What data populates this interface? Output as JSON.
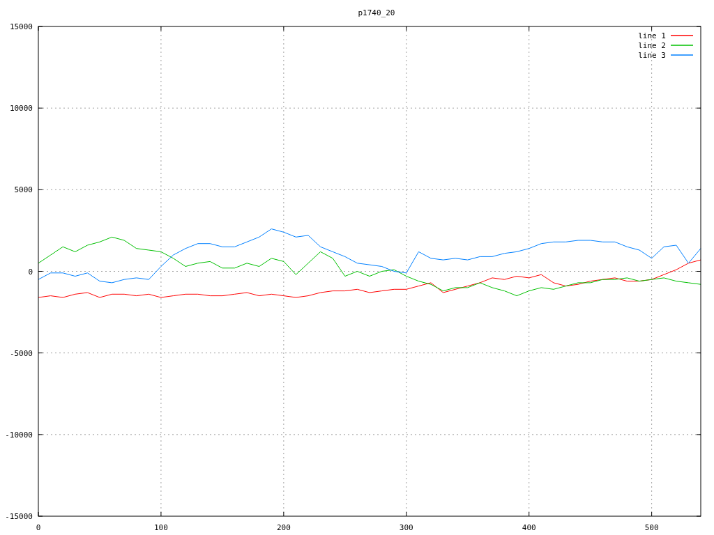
{
  "chart_data": {
    "type": "line",
    "title": "p1740_20",
    "x": [
      0,
      10,
      20,
      30,
      40,
      50,
      60,
      70,
      80,
      90,
      100,
      110,
      120,
      130,
      140,
      150,
      160,
      170,
      180,
      190,
      200,
      210,
      220,
      230,
      240,
      250,
      260,
      270,
      280,
      290,
      300,
      310,
      320,
      330,
      340,
      350,
      360,
      370,
      380,
      390,
      400,
      410,
      420,
      430,
      440,
      450,
      460,
      470,
      480,
      490,
      500,
      510,
      520,
      530,
      540
    ],
    "series": [
      {
        "name": "line 1",
        "color": "#ff0000",
        "values": [
          -1600,
          -1500,
          -1600,
          -1400,
          -1300,
          -1600,
          -1400,
          -1400,
          -1500,
          -1400,
          -1600,
          -1500,
          -1400,
          -1400,
          -1500,
          -1500,
          -1400,
          -1300,
          -1500,
          -1400,
          -1500,
          -1600,
          -1500,
          -1300,
          -1200,
          -1200,
          -1100,
          -1300,
          -1200,
          -1100,
          -1100,
          -900,
          -700,
          -1300,
          -1100,
          -900,
          -700,
          -400,
          -500,
          -300,
          -400,
          -200,
          -700,
          -900,
          -800,
          -600,
          -500,
          -400,
          -600,
          -600,
          -500,
          -200,
          100,
          500,
          700
        ]
      },
      {
        "name": "line 2",
        "color": "#00c000",
        "values": [
          500,
          1000,
          1500,
          1200,
          1600,
          1800,
          2100,
          1900,
          1400,
          1300,
          1200,
          800,
          300,
          500,
          600,
          200,
          200,
          500,
          300,
          800,
          600,
          -200,
          500,
          1200,
          800,
          -300,
          0,
          -300,
          0,
          100,
          -300,
          -600,
          -800,
          -1200,
          -1000,
          -1000,
          -700,
          -1000,
          -1200,
          -1500,
          -1200,
          -1000,
          -1100,
          -900,
          -700,
          -700,
          -500,
          -500,
          -400,
          -600,
          -500,
          -400,
          -600,
          -700,
          -800
        ]
      },
      {
        "name": "line 3",
        "color": "#0080ff",
        "values": [
          -500,
          -100,
          -100,
          -300,
          -100,
          -600,
          -700,
          -500,
          -400,
          -500,
          300,
          1000,
          1400,
          1700,
          1700,
          1500,
          1500,
          1800,
          2100,
          2600,
          2400,
          2100,
          2200,
          1500,
          1200,
          900,
          500,
          400,
          300,
          0,
          -100,
          1200,
          800,
          700,
          800,
          700,
          900,
          900,
          1100,
          1200,
          1400,
          1700,
          1800,
          1800,
          1900,
          1900,
          1800,
          1800,
          1500,
          1300,
          800,
          1500,
          1600,
          500,
          1400
        ]
      }
    ],
    "xlim": [
      0,
      540
    ],
    "ylim": [
      -15000,
      15000
    ],
    "xticks": [
      0,
      100,
      200,
      300,
      400,
      500
    ],
    "yticks": [
      -15000,
      -10000,
      -5000,
      0,
      5000,
      10000,
      15000
    ],
    "grid": true,
    "legend": true
  }
}
